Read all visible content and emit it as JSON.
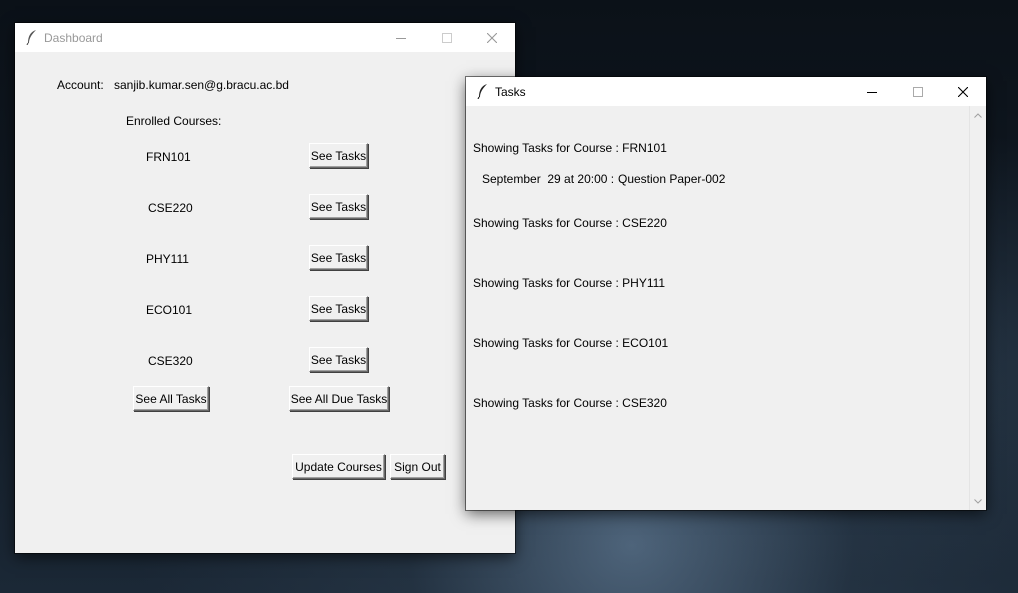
{
  "dashboard": {
    "title": "Dashboard",
    "account_label": "Account:",
    "account_email": "sanjib.kumar.sen@g.bracu.ac.bd",
    "enrolled_label": "Enrolled Courses:",
    "courses": [
      {
        "code": "FRN101",
        "button": "See Tasks"
      },
      {
        "code": "CSE220",
        "button": "See Tasks"
      },
      {
        "code": "PHY111",
        "button": "See Tasks"
      },
      {
        "code": "ECO101",
        "button": "See Tasks"
      },
      {
        "code": "CSE320",
        "button": "See Tasks"
      }
    ],
    "see_all_tasks": "See All Tasks",
    "see_all_due_tasks": "See All Due Tasks",
    "update_courses": "Update Courses",
    "sign_out": "Sign Out"
  },
  "tasks": {
    "title": "Tasks",
    "sections": [
      {
        "heading": "Showing Tasks for Course : FRN101",
        "items": [
          {
            "date": "September  29 at 20:00 :",
            "name": "Question Paper-002"
          }
        ]
      },
      {
        "heading": "Showing Tasks for Course : CSE220",
        "items": []
      },
      {
        "heading": "Showing Tasks for Course : PHY111",
        "items": []
      },
      {
        "heading": "Showing Tasks for Course : ECO101",
        "items": []
      },
      {
        "heading": "Showing Tasks for Course : CSE320",
        "items": []
      }
    ]
  },
  "icons": {
    "app": "feather-icon",
    "minimize": "minimize-icon",
    "maximize": "maximize-icon",
    "close": "close-icon"
  }
}
